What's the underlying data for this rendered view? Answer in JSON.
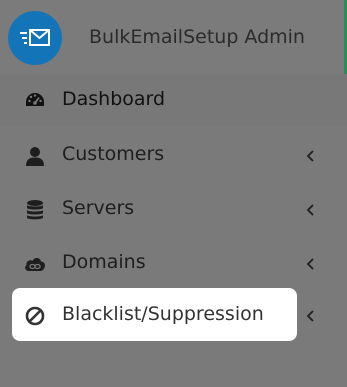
{
  "brand": {
    "title": "BulkEmailSetup Admin",
    "logo_icon": "email-icon",
    "logo_color": "#1474b8",
    "accent_color": "#2e8b57"
  },
  "menu": {
    "items": [
      {
        "label": "Dashboard",
        "icon": "speedometer-icon",
        "has_submenu": false
      },
      {
        "label": "Customers",
        "icon": "user-icon",
        "has_submenu": true
      },
      {
        "label": "Servers",
        "icon": "database-icon",
        "has_submenu": true
      },
      {
        "label": "Domains",
        "icon": "cloud-link-icon",
        "has_submenu": true
      },
      {
        "label": "Blacklist/Suppression",
        "icon": "ban-icon",
        "has_submenu": true,
        "highlighted": true
      }
    ]
  }
}
